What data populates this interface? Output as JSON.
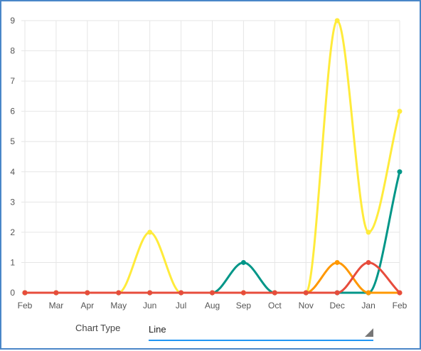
{
  "chart_data": {
    "type": "line",
    "categories": [
      "Feb",
      "Mar",
      "Apr",
      "May",
      "Jun",
      "Jul",
      "Aug",
      "Sep",
      "Oct",
      "Nov",
      "Dec",
      "Jan",
      "Feb"
    ],
    "ylim": [
      0,
      9
    ],
    "yticks": [
      0,
      1,
      2,
      3,
      4,
      5,
      6,
      7,
      8,
      9
    ],
    "grid": true,
    "series": [
      {
        "color": "#ffeb3b",
        "values": [
          0,
          0,
          0,
          0,
          2,
          0,
          0,
          0,
          0,
          0,
          9,
          2,
          6
        ]
      },
      {
        "color": "#009688",
        "values": [
          0,
          0,
          0,
          0,
          0,
          0,
          0,
          1,
          0,
          0,
          0,
          0,
          4
        ]
      },
      {
        "color": "#ff9800",
        "values": [
          0,
          0,
          0,
          0,
          0,
          0,
          0,
          0,
          0,
          0,
          1,
          0,
          0
        ]
      },
      {
        "color": "#e74c3c",
        "values": [
          0,
          0,
          0,
          0,
          0,
          0,
          0,
          0,
          0,
          0,
          0,
          1,
          0
        ]
      }
    ]
  },
  "controls": {
    "chart_type_label": "Chart Type",
    "chart_type_value": "Line"
  }
}
